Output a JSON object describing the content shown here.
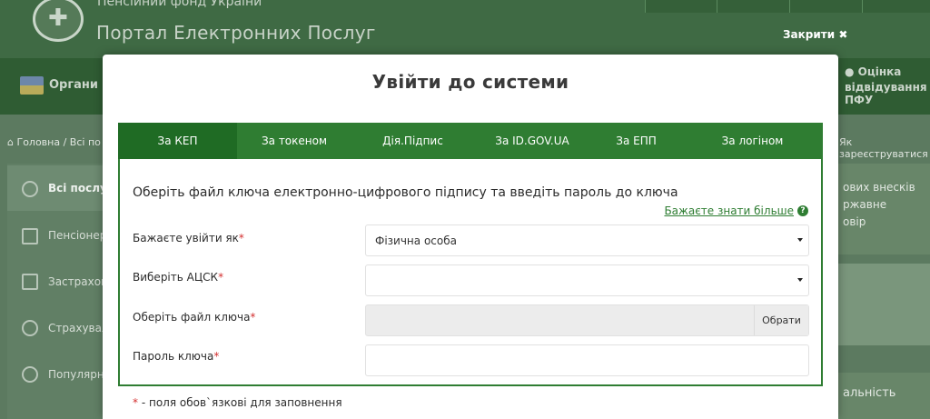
{
  "background": {
    "org_name": "Пенсійний фонд України",
    "portal_name": "Портал Електронних Послуг",
    "close_label": "Закрити",
    "nav_left": "Органи П",
    "nav_right_line1": "Оцінка",
    "nav_right_line2": "відвідування ПФУ",
    "breadcrumb": "Головна / Всі по",
    "register_link": "Як зареєструватися",
    "sidebar_items": [
      "Всі послуги",
      "Пенсіонер",
      "Застрахова",
      "Страхувал",
      "Популярні"
    ],
    "right_text_lines": [
      "ових внесків",
      "ржавне",
      "овір"
    ],
    "right_text_bottom": "альність"
  },
  "modal": {
    "title": "Увійти до системи",
    "tabs": [
      {
        "label": "За КЕП",
        "active": true
      },
      {
        "label": "За токеном",
        "active": false
      },
      {
        "label": "Дія.Підпис",
        "active": false
      },
      {
        "label": "За ID.GOV.UA",
        "active": false
      },
      {
        "label": "За ЕПП",
        "active": false
      },
      {
        "label": "За логіном",
        "active": false
      }
    ],
    "heading": "Оберіть файл ключа електронно-цифрового підпису та введіть пароль до ключа",
    "learn_more": "Бажаєте знати більше",
    "fields": {
      "login_as_label": "Бажаєте увійти як",
      "login_as_value": "Фізична особа",
      "acsk_label": "Виберіть АЦСК",
      "acsk_value": "",
      "key_file_label": "Оберіть файл ключа",
      "key_file_button": "Обрати",
      "password_label": "Пароль ключа",
      "password_value": ""
    },
    "required_mark": "*",
    "footnote": "- поля обов`язкові для заповнення"
  },
  "colors": {
    "tab_bg": "#2f7d32",
    "tab_active": "#1f6b24",
    "link": "#2e7d32",
    "required": "#d32f2f"
  }
}
